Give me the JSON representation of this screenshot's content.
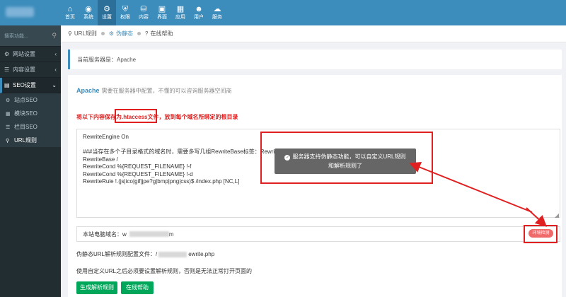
{
  "top_nav": [
    {
      "label": "首页",
      "icon": "home-icon",
      "glyph": "⌂"
    },
    {
      "label": "系统",
      "icon": "globe-icon",
      "glyph": "◉"
    },
    {
      "label": "设置",
      "icon": "gear-icon",
      "glyph": "⚙"
    },
    {
      "label": "权限",
      "icon": "shield-icon",
      "glyph": "⛨"
    },
    {
      "label": "内容",
      "icon": "database-icon",
      "glyph": "⛁"
    },
    {
      "label": "界面",
      "icon": "html5-icon",
      "glyph": "▣"
    },
    {
      "label": "应用",
      "icon": "apps-icon",
      "glyph": "▦"
    },
    {
      "label": "用户",
      "icon": "user-icon",
      "glyph": "☻"
    },
    {
      "label": "服务",
      "icon": "cloud-icon",
      "glyph": "☁"
    }
  ],
  "sidebar": {
    "search_placeholder": "搜索功能...",
    "items": [
      {
        "label": "网站设置",
        "icon": "gear-icon",
        "glyph": "⚙"
      },
      {
        "label": "内容设置",
        "icon": "list-icon",
        "glyph": "☰"
      },
      {
        "label": "SEO设置",
        "icon": "chart-icon",
        "glyph": "▤"
      }
    ],
    "sub_items": [
      {
        "label": "站点SEO",
        "icon": "gear-icon",
        "glyph": "⚙"
      },
      {
        "label": "模块SEO",
        "icon": "grid-icon",
        "glyph": "▦"
      },
      {
        "label": "栏目SEO",
        "icon": "list-icon",
        "glyph": "☰"
      },
      {
        "label": "URL规则",
        "icon": "link-icon",
        "glyph": "⚲"
      }
    ]
  },
  "tabs": [
    {
      "label": "URL规则",
      "glyph": "⚲"
    },
    {
      "label": "伪静态",
      "glyph": "⚙"
    },
    {
      "label": "在线帮助",
      "glyph": "?"
    }
  ],
  "server": {
    "label": "当前服务器是：Apache"
  },
  "apache": {
    "name": "Apache",
    "desc": "需要在服务器中配置，不懂的可以咨询服务器空间商"
  },
  "note": "将以下内容保存为.htaccess文件，放到每个域名所绑定的根目录",
  "code_lines": [
    "RewriteEngine On",
    "",
    "###当存在多个子目录格式的域名时，需要多写几组RewriteBase标签：RewriteBase /目录/",
    "RewriteBase /",
    "RewriteCond %{REQUEST_FILENAME} !-f",
    "RewriteCond %{REQUEST_FILENAME} !-d",
    "RewriteRule !.(js|ico|gif|jpe?g|bmp|png|css)$ /index.php [NC,L]"
  ],
  "tooltip": {
    "line1": "服务器支持伪静态功能，可以自定义URL规则",
    "line2": "和解析规则了"
  },
  "domain": {
    "label": "本站电脑域名：",
    "prefix": "w",
    "suffix": "m"
  },
  "env_button": "环境检测",
  "config_file": {
    "prefix": "伪静态URL解析规则配置文件：/",
    "suffix": "ewrite.php"
  },
  "hint": "使用自定义URL之后必须要设置解析规则，否则是无法正常打开页面的",
  "buttons": {
    "generate": "生成解析规则",
    "help": "在线帮助"
  },
  "colors": {
    "primary": "#3c8dbc",
    "sidebar": "#222d32",
    "success": "#00a65a",
    "annotation": "#e02020"
  }
}
